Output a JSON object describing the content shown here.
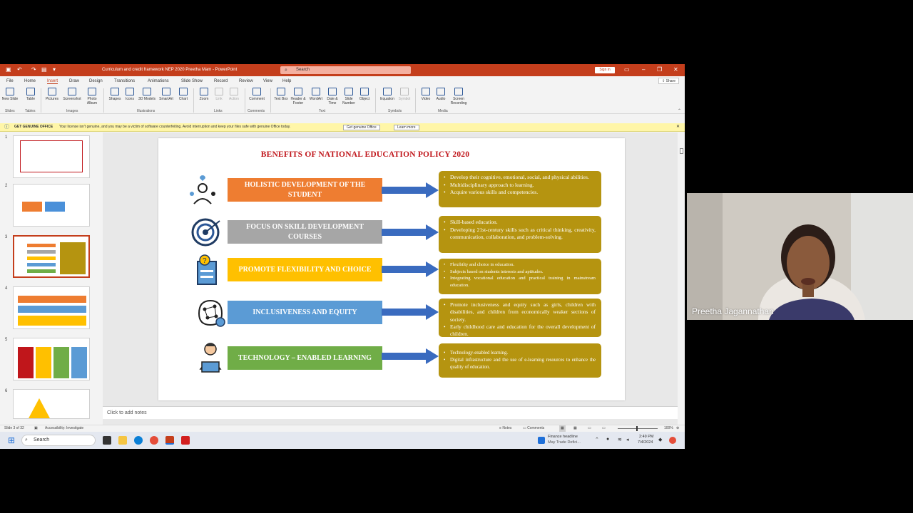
{
  "window": {
    "doc_title": "Curriculum and credit framework NEP 2020 Preetha Mam  -  PowerPoint",
    "search_placeholder": "Search",
    "signin_label": "Sign in",
    "accent_color": "#c43e1c"
  },
  "menu_tabs": [
    "File",
    "Home",
    "Insert",
    "Draw",
    "Design",
    "Transitions",
    "Animations",
    "Slide Show",
    "Record",
    "Review",
    "View",
    "Help"
  ],
  "active_tab": "Insert",
  "share_label": "Share",
  "ribbon": {
    "buttons": [
      {
        "label": "New Slide",
        "icon": "new-slide-icon"
      },
      {
        "label": "Table",
        "icon": "table-icon"
      },
      {
        "label": "Pictures",
        "icon": "pictures-icon"
      },
      {
        "label": "Screenshot",
        "icon": "screenshot-icon"
      },
      {
        "label": "Photo Album",
        "icon": "photo-album-icon"
      },
      {
        "label": "Shapes",
        "icon": "shapes-icon"
      },
      {
        "label": "Icons",
        "icon": "icons-icon"
      },
      {
        "label": "3D Models",
        "icon": "3d-models-icon"
      },
      {
        "label": "SmartArt",
        "icon": "smartart-icon"
      },
      {
        "label": "Chart",
        "icon": "chart-icon"
      },
      {
        "label": "Zoom",
        "icon": "zoom-icon"
      },
      {
        "label": "Link",
        "icon": "link-icon"
      },
      {
        "label": "Action",
        "icon": "action-icon"
      },
      {
        "label": "Comment",
        "icon": "comment-icon"
      },
      {
        "label": "Text Box",
        "icon": "text-box-icon"
      },
      {
        "label": "Header & Footer",
        "icon": "header-footer-icon"
      },
      {
        "label": "WordArt",
        "icon": "wordart-icon"
      },
      {
        "label": "Date & Time",
        "icon": "date-time-icon"
      },
      {
        "label": "Slide Number",
        "icon": "slide-number-icon"
      },
      {
        "label": "Object",
        "icon": "object-icon"
      },
      {
        "label": "Equation",
        "icon": "equation-icon"
      },
      {
        "label": "Symbol",
        "icon": "symbol-icon"
      },
      {
        "label": "Video",
        "icon": "video-icon"
      },
      {
        "label": "Audio",
        "icon": "audio-icon"
      },
      {
        "label": "Screen Recording",
        "icon": "screen-recording-icon"
      }
    ],
    "groups": [
      "Slides",
      "Tables",
      "Images",
      "Illustrations",
      "Links",
      "Comments",
      "Text",
      "Symbols",
      "Media"
    ]
  },
  "infobar": {
    "title": "GET GENUINE OFFICE",
    "message": "Your license isn't genuine, and you may be a victim of software counterfeiting. Avoid interruption and keep your files safe with genuine Office today.",
    "button_primary": "Get genuine Office",
    "button_secondary": "Learn more"
  },
  "thumbnails": [
    "1",
    "2",
    "3",
    "4",
    "5",
    "6"
  ],
  "active_thumbnail": "3",
  "slide": {
    "title": "BENEFITS OF NATIONAL EDUCATION POLICY 2020",
    "rows": [
      {
        "heading": "HOLISTIC DEVELOPMENT OF THE STUDENT",
        "color": "#ee7d31",
        "icon": "person-heart-icon",
        "points": [
          "Develop their cognitive, emotional, social, and physical abilities.",
          "Multidisciplinary approach to learning.",
          "Acquire various skills and competencies."
        ]
      },
      {
        "heading": "FOCUS ON SKILL DEVELOPMENT COURSES",
        "color": "#a6a6a6",
        "icon": "target-icon",
        "points": [
          "Skill-based education.",
          "Developing 21st-century skills such as critical thinking, creativity, communication, collaboration, and problem-solving."
        ]
      },
      {
        "heading": "PROMOTE FLEXIBILITY AND CHOICE",
        "color": "#ffc000",
        "icon": "question-document-icon",
        "points": [
          "Flexibilty and choice in education.",
          "Subjects based on students interests and aptitudes.",
          "Integrating vocational education and practical training in mainstream education."
        ]
      },
      {
        "heading": "INCLUSIVENESS AND EQUITY",
        "color": "#5b9bd5",
        "icon": "brain-gear-icon",
        "points": [
          "Promote inclusiveness and equity such as girls, children with disabilities, and children from economically weaker sections of society.",
          "Early childhood care and education for the overall development of children."
        ]
      },
      {
        "heading": "TECHNOLOGY – ENABLED LEARNING",
        "color": "#70ad47",
        "icon": "student-laptop-icon",
        "points": [
          "Technology-enabled learning.",
          "Digital infrastructure and the use of e-learning resources to enhance the quality of education."
        ]
      }
    ],
    "box_color": "#b59410",
    "arrow_color": "#3a6bbf"
  },
  "notes_placeholder": "Click to add notes",
  "status": {
    "slide_indicator": "Slide 3 of 32",
    "accessibility": "Accessibility: Investigate",
    "notes": "Notes",
    "comments": "Comments",
    "zoom": "100%"
  },
  "taskbar": {
    "search_label": "Search",
    "news_title": "Finance headline",
    "news_sub": "May Trade Defici...",
    "time": "2:49 PM",
    "date": "7/4/2024"
  },
  "webcam": {
    "participant_name": "Preetha Jagannathan"
  }
}
